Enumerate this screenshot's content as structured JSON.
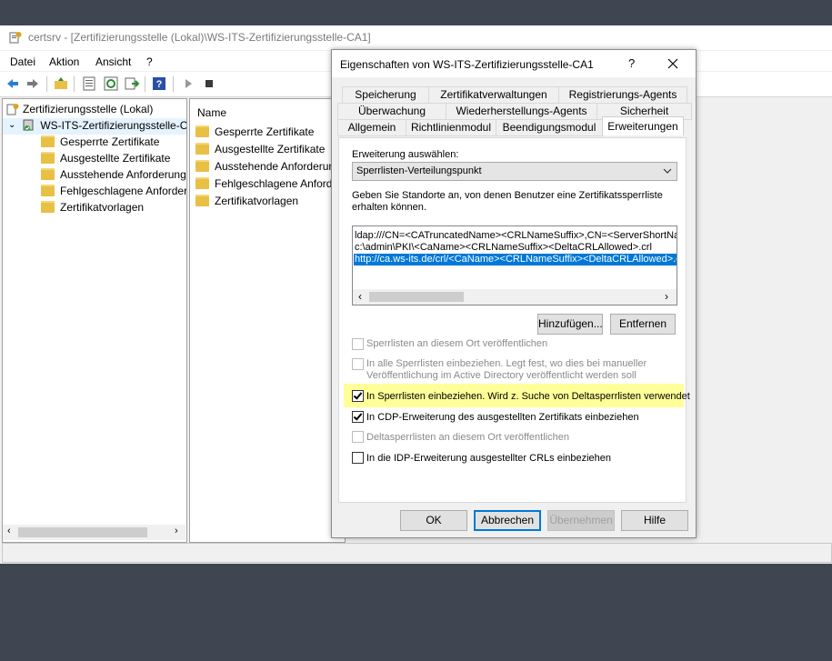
{
  "window": {
    "title": "certsrv - [Zertifizierungsstelle (Lokal)\\WS-ITS-Zertifizierungsstelle-CA1]"
  },
  "menu": [
    "Datei",
    "Aktion",
    "Ansicht",
    "?"
  ],
  "toolbar_icons": [
    "back-arrow-icon",
    "forward-arrow-icon",
    "up-folder-icon",
    "properties-icon",
    "refresh-icon",
    "export-icon",
    "help-icon",
    "play-icon",
    "stop-icon"
  ],
  "tree": {
    "root": "Zertifizierungsstelle (Lokal)",
    "ca": "WS-ITS-Zertifizierungsstelle-CA1",
    "items": [
      "Gesperrte Zertifikate",
      "Ausgestellte Zertifikate",
      "Ausstehende Anforderungen",
      "Fehlgeschlagene Anforderungen",
      "Zertifikatvorlagen"
    ]
  },
  "list": {
    "header": "Name",
    "items": [
      "Gesperrte Zertifikate",
      "Ausgestellte Zertifikate",
      "Ausstehende Anforderungen",
      "Fehlgeschlagene Anforderungen",
      "Zertifikatvorlagen"
    ]
  },
  "dialog": {
    "title": "Eigenschaften von WS-ITS-Zertifizierungsstelle-CA1",
    "help_glyph": "?",
    "tabs_row1": [
      "Speicherung",
      "Zertifikatverwaltungen",
      "Registrierungs-Agents"
    ],
    "tabs_row2": [
      "Überwachung",
      "Wiederherstellungs-Agents",
      "Sicherheit"
    ],
    "tabs_row3": [
      "Allgemein",
      "Richtlinienmodul",
      "Beendigungsmodul",
      "Erweiterungen"
    ],
    "active_tab": "Erweiterungen",
    "select_label": "Erweiterung auswählen:",
    "select_value": "Sperrlisten-Verteilungspunkt",
    "description": "Geben Sie Standorte an, von denen Benutzer eine Zertifikatssperrliste",
    "description2": "erhalten können.",
    "locations": [
      "ldap:///CN=<CATruncatedName><CRLNameSuffix>,CN=<ServerShortNar",
      "c:\\admin\\PKI\\<CaName><CRLNameSuffix><DeltaCRLAllowed>.crl",
      "http://ca.ws-its.de/crl/<CaName><CRLNameSuffix><DeltaCRLAllowed>.c"
    ],
    "selected_location_index": 2,
    "add_button": "Hinzufügen...",
    "remove_button": "Entfernen",
    "checkboxes": [
      {
        "label": "Sperrlisten an diesem Ort veröffentlichen",
        "checked": false,
        "enabled": false
      },
      {
        "label": "In alle Sperrlisten einbeziehen. Legt fest, wo dies bei manueller",
        "label2": "Veröffentlichung im Active Directory veröffentlicht werden soll",
        "checked": false,
        "enabled": false
      },
      {
        "label": "In Sperrlisten einbeziehen. Wird z. Suche von Deltasperrlisten verwendet",
        "checked": true,
        "enabled": true,
        "highlighted": true
      },
      {
        "label": "In CDP-Erweiterung des ausgestellten Zertifikats einbeziehen",
        "checked": true,
        "enabled": true
      },
      {
        "label": "Deltasperrlisten an diesem Ort veröffentlichen",
        "checked": false,
        "enabled": false
      },
      {
        "label": "In die IDP-Erweiterung ausgestellter CRLs einbeziehen",
        "checked": false,
        "enabled": true
      }
    ],
    "ok_button": "OK",
    "cancel_button": "Abbrechen",
    "apply_button": "Übernehmen",
    "help_button": "Hilfe"
  },
  "colors": {
    "selection": "#0078d7",
    "highlight_marker": "#ffff99",
    "desktop": "#3f4652"
  }
}
